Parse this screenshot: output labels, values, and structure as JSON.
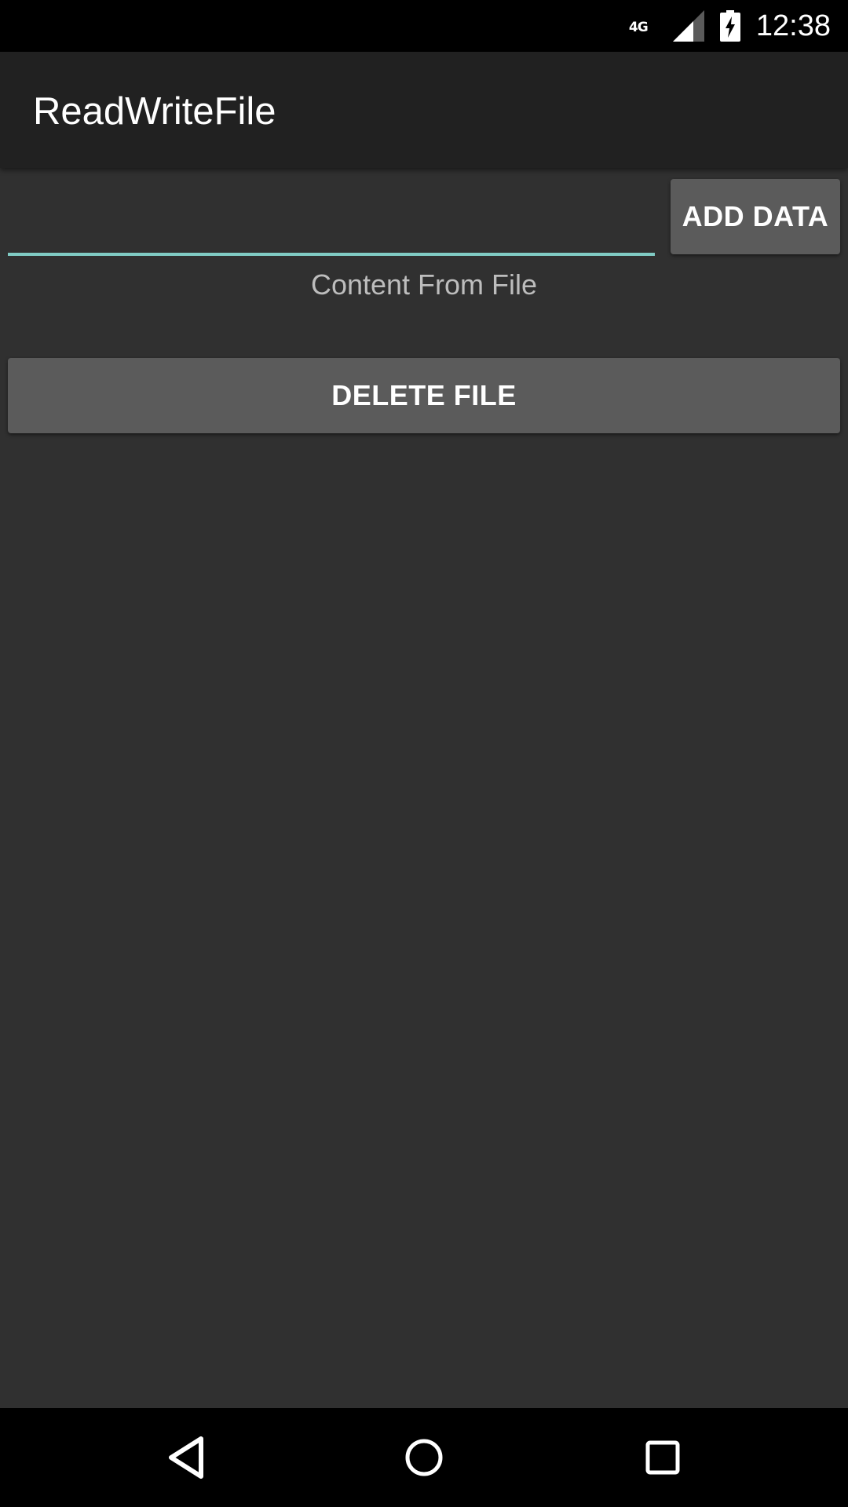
{
  "status_bar": {
    "network_label": "4G",
    "time": "12:38",
    "icons": [
      "signal-icon",
      "battery-charging-icon"
    ]
  },
  "app_bar": {
    "title": "ReadWriteFile"
  },
  "main": {
    "input": {
      "value": "",
      "placeholder": ""
    },
    "add_button_label": "ADD DATA",
    "content_text": "Content From File",
    "delete_button_label": "DELETE FILE"
  },
  "nav_bar": {
    "icons": [
      "back-icon",
      "home-icon",
      "recents-icon"
    ]
  },
  "colors": {
    "background": "#303030",
    "app_bar": "#212121",
    "accent": "#80cbc4",
    "button": "#5b5b5b"
  }
}
